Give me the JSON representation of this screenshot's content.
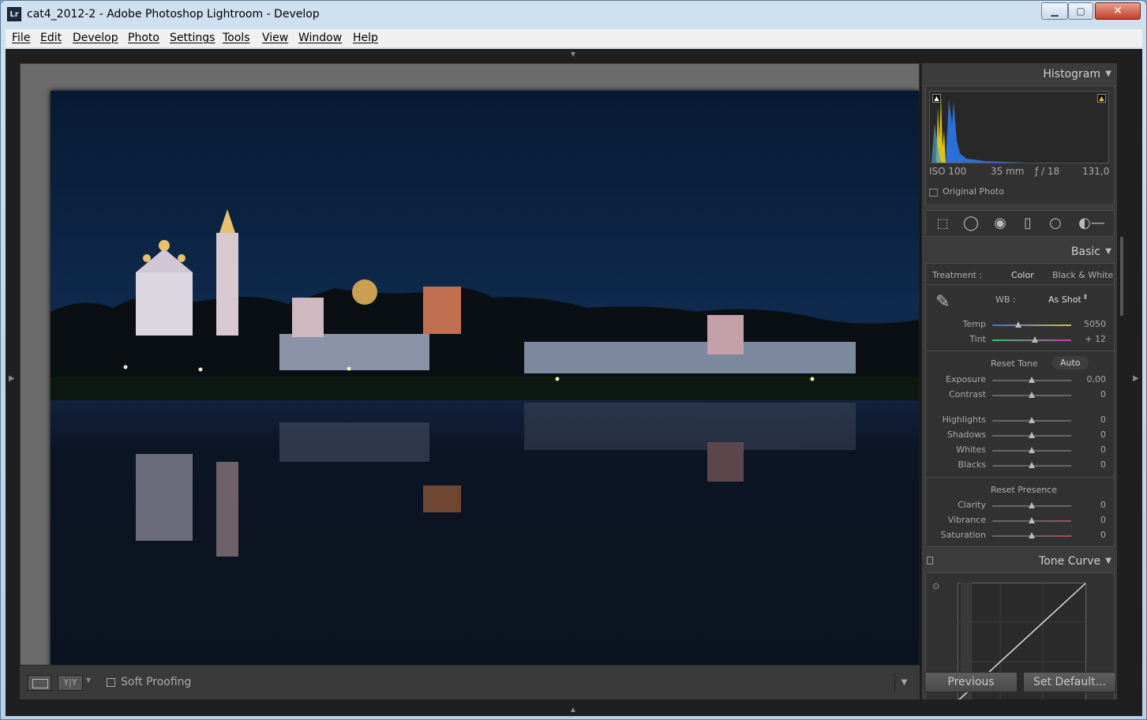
{
  "window": {
    "app_icon": "Lr",
    "title": "cat4_2012-2 - Adobe Photoshop Lightroom - Develop",
    "minimize_icon": "minimize-icon",
    "maximize_icon": "maximize-icon",
    "close_icon": "close-icon"
  },
  "menu": [
    "File",
    "Edit",
    "Develop",
    "Photo",
    "Settings",
    "Tools",
    "View",
    "Window",
    "Help"
  ],
  "toolbar": {
    "view_icon": "loupe-view-icon",
    "yy_label": "Y|Y",
    "soft_proofing_label": "Soft Proofing",
    "soft_proofing_checked": false
  },
  "histogram": {
    "title": "Histogram",
    "iso": "ISO 100",
    "focal": "35 mm",
    "aperture": "ƒ / 18",
    "shutter": "131,0",
    "original_photo_label": "Original Photo",
    "colors": {
      "blue": "#2c6fd6",
      "yellow": "#d9c21a",
      "cyan": "#4aa0c8"
    }
  },
  "tools": [
    "crop-overlay-icon",
    "spot-removal-icon",
    "red-eye-icon",
    "graduated-filter-icon",
    "radial-filter-icon",
    "adjustment-brush-icon"
  ],
  "basic": {
    "title": "Basic",
    "treatment_label": "Treatment :",
    "treatment_color": "Color",
    "treatment_bw": "Black & White",
    "wb_label": "WB :",
    "wb_value": "As Shot",
    "eyedropper_icon": "eyedropper-icon",
    "temp": {
      "label": "Temp",
      "value": "5050",
      "fraction": 0.33
    },
    "tint": {
      "label": "Tint",
      "value": "+ 12",
      "fraction": 0.54
    },
    "reset_tone_label": "Reset Tone",
    "auto_label": "Auto",
    "tone": [
      {
        "label": "Exposure",
        "value": "0,00",
        "fraction": 0.5
      },
      {
        "label": "Contrast",
        "value": "0",
        "fraction": 0.5
      }
    ],
    "tone2": [
      {
        "label": "Highlights",
        "value": "0",
        "fraction": 0.5
      },
      {
        "label": "Shadows",
        "value": "0",
        "fraction": 0.5
      },
      {
        "label": "Whites",
        "value": "0",
        "fraction": 0.5
      },
      {
        "label": "Blacks",
        "value": "0",
        "fraction": 0.5
      }
    ],
    "reset_presence_label": "Reset Presence",
    "presence": [
      {
        "label": "Clarity",
        "value": "0",
        "fraction": 0.5
      },
      {
        "label": "Vibrance",
        "value": "0",
        "fraction": 0.5
      },
      {
        "label": "Saturation",
        "value": "0",
        "fraction": 0.5
      }
    ]
  },
  "tone_curve": {
    "title": "Tone Curve"
  },
  "buttons": {
    "previous": "Previous",
    "set_default": "Set Default..."
  }
}
